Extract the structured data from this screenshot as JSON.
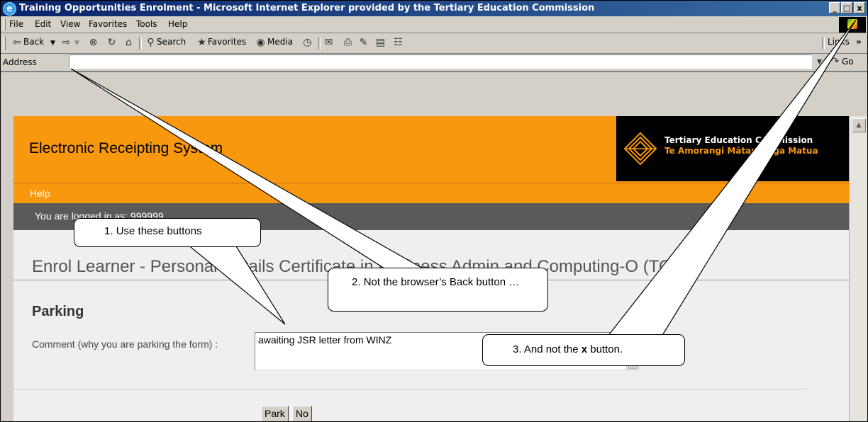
{
  "window": {
    "title": "Training Opportunities Enrolment - Microsoft Internet Explorer provided by the Tertiary Education Commission",
    "minimize": "_",
    "maximize": "□",
    "close": "x"
  },
  "menu": [
    "File",
    "Edit",
    "View",
    "Favorites",
    "Tools",
    "Help"
  ],
  "toolbar": {
    "back": "Back",
    "search": "Search",
    "favorites": "Favorites",
    "media": "Media",
    "links": "Links"
  },
  "address": {
    "label": "Address",
    "go": "Go",
    "value": ""
  },
  "page": {
    "app_title": "Electronic Receipting System",
    "org_name_en": "Tertiary Education Commission",
    "org_name_mi": "Te Amorangi Mātauranga Matua",
    "help": "Help",
    "user_bar": "You are logged in as: 999999",
    "heading": "Enrol Learner - Personal Details    Certificate in Business Admin and Computing-O (TOP)",
    "section_title": "Parking",
    "comment_label": "Comment (why you are parking the form) :",
    "comment_value": "awaiting JSR letter from WINZ",
    "buttons": {
      "park": "Park",
      "no": "No"
    }
  },
  "callouts": [
    {
      "number": "1.",
      "text": "Use these buttons"
    },
    {
      "number": "2.",
      "text": "Not the browser’s Back button …"
    },
    {
      "number": "3.",
      "pre": "And not the ",
      "bold": "x",
      "post": " button."
    }
  ]
}
